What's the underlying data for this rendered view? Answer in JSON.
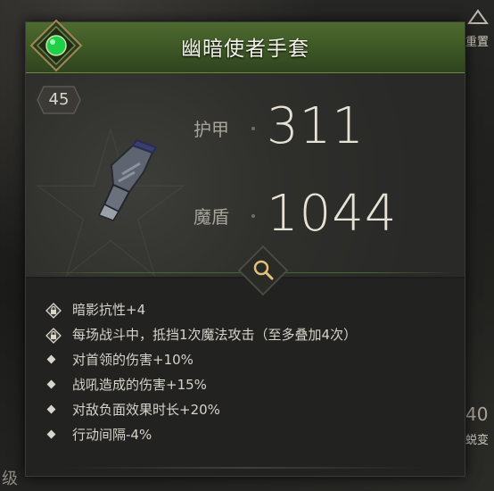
{
  "item": {
    "name": "幽暗使者手套",
    "level": "45",
    "stats": [
      {
        "label": "护甲",
        "value": "311"
      },
      {
        "label": "魔盾",
        "value": "1044"
      }
    ],
    "affixes": [
      {
        "icon": "lock-icon",
        "text": "暗影抗性+4"
      },
      {
        "icon": "lock-icon",
        "text": "每场战斗中，抵挡1次魔法攻击（至多叠加4次）"
      },
      {
        "icon": "diamond-bullet-icon",
        "text": "对首领的伤害+10%"
      },
      {
        "icon": "diamond-bullet-icon",
        "text": "战吼造成的伤害+15%"
      },
      {
        "icon": "diamond-bullet-icon",
        "text": "对敌负面效果时长+20%"
      },
      {
        "icon": "diamond-bullet-icon",
        "text": "行动间隔-4%"
      }
    ]
  },
  "background": {
    "right_top_label": "重置",
    "right_level": "40",
    "right_bottom_label": "蜕变",
    "left_bottom_label": "级"
  },
  "colors": {
    "title_bar": "#3c5624",
    "accent_green": "#2bd14a",
    "text": "#d6d3c9"
  }
}
